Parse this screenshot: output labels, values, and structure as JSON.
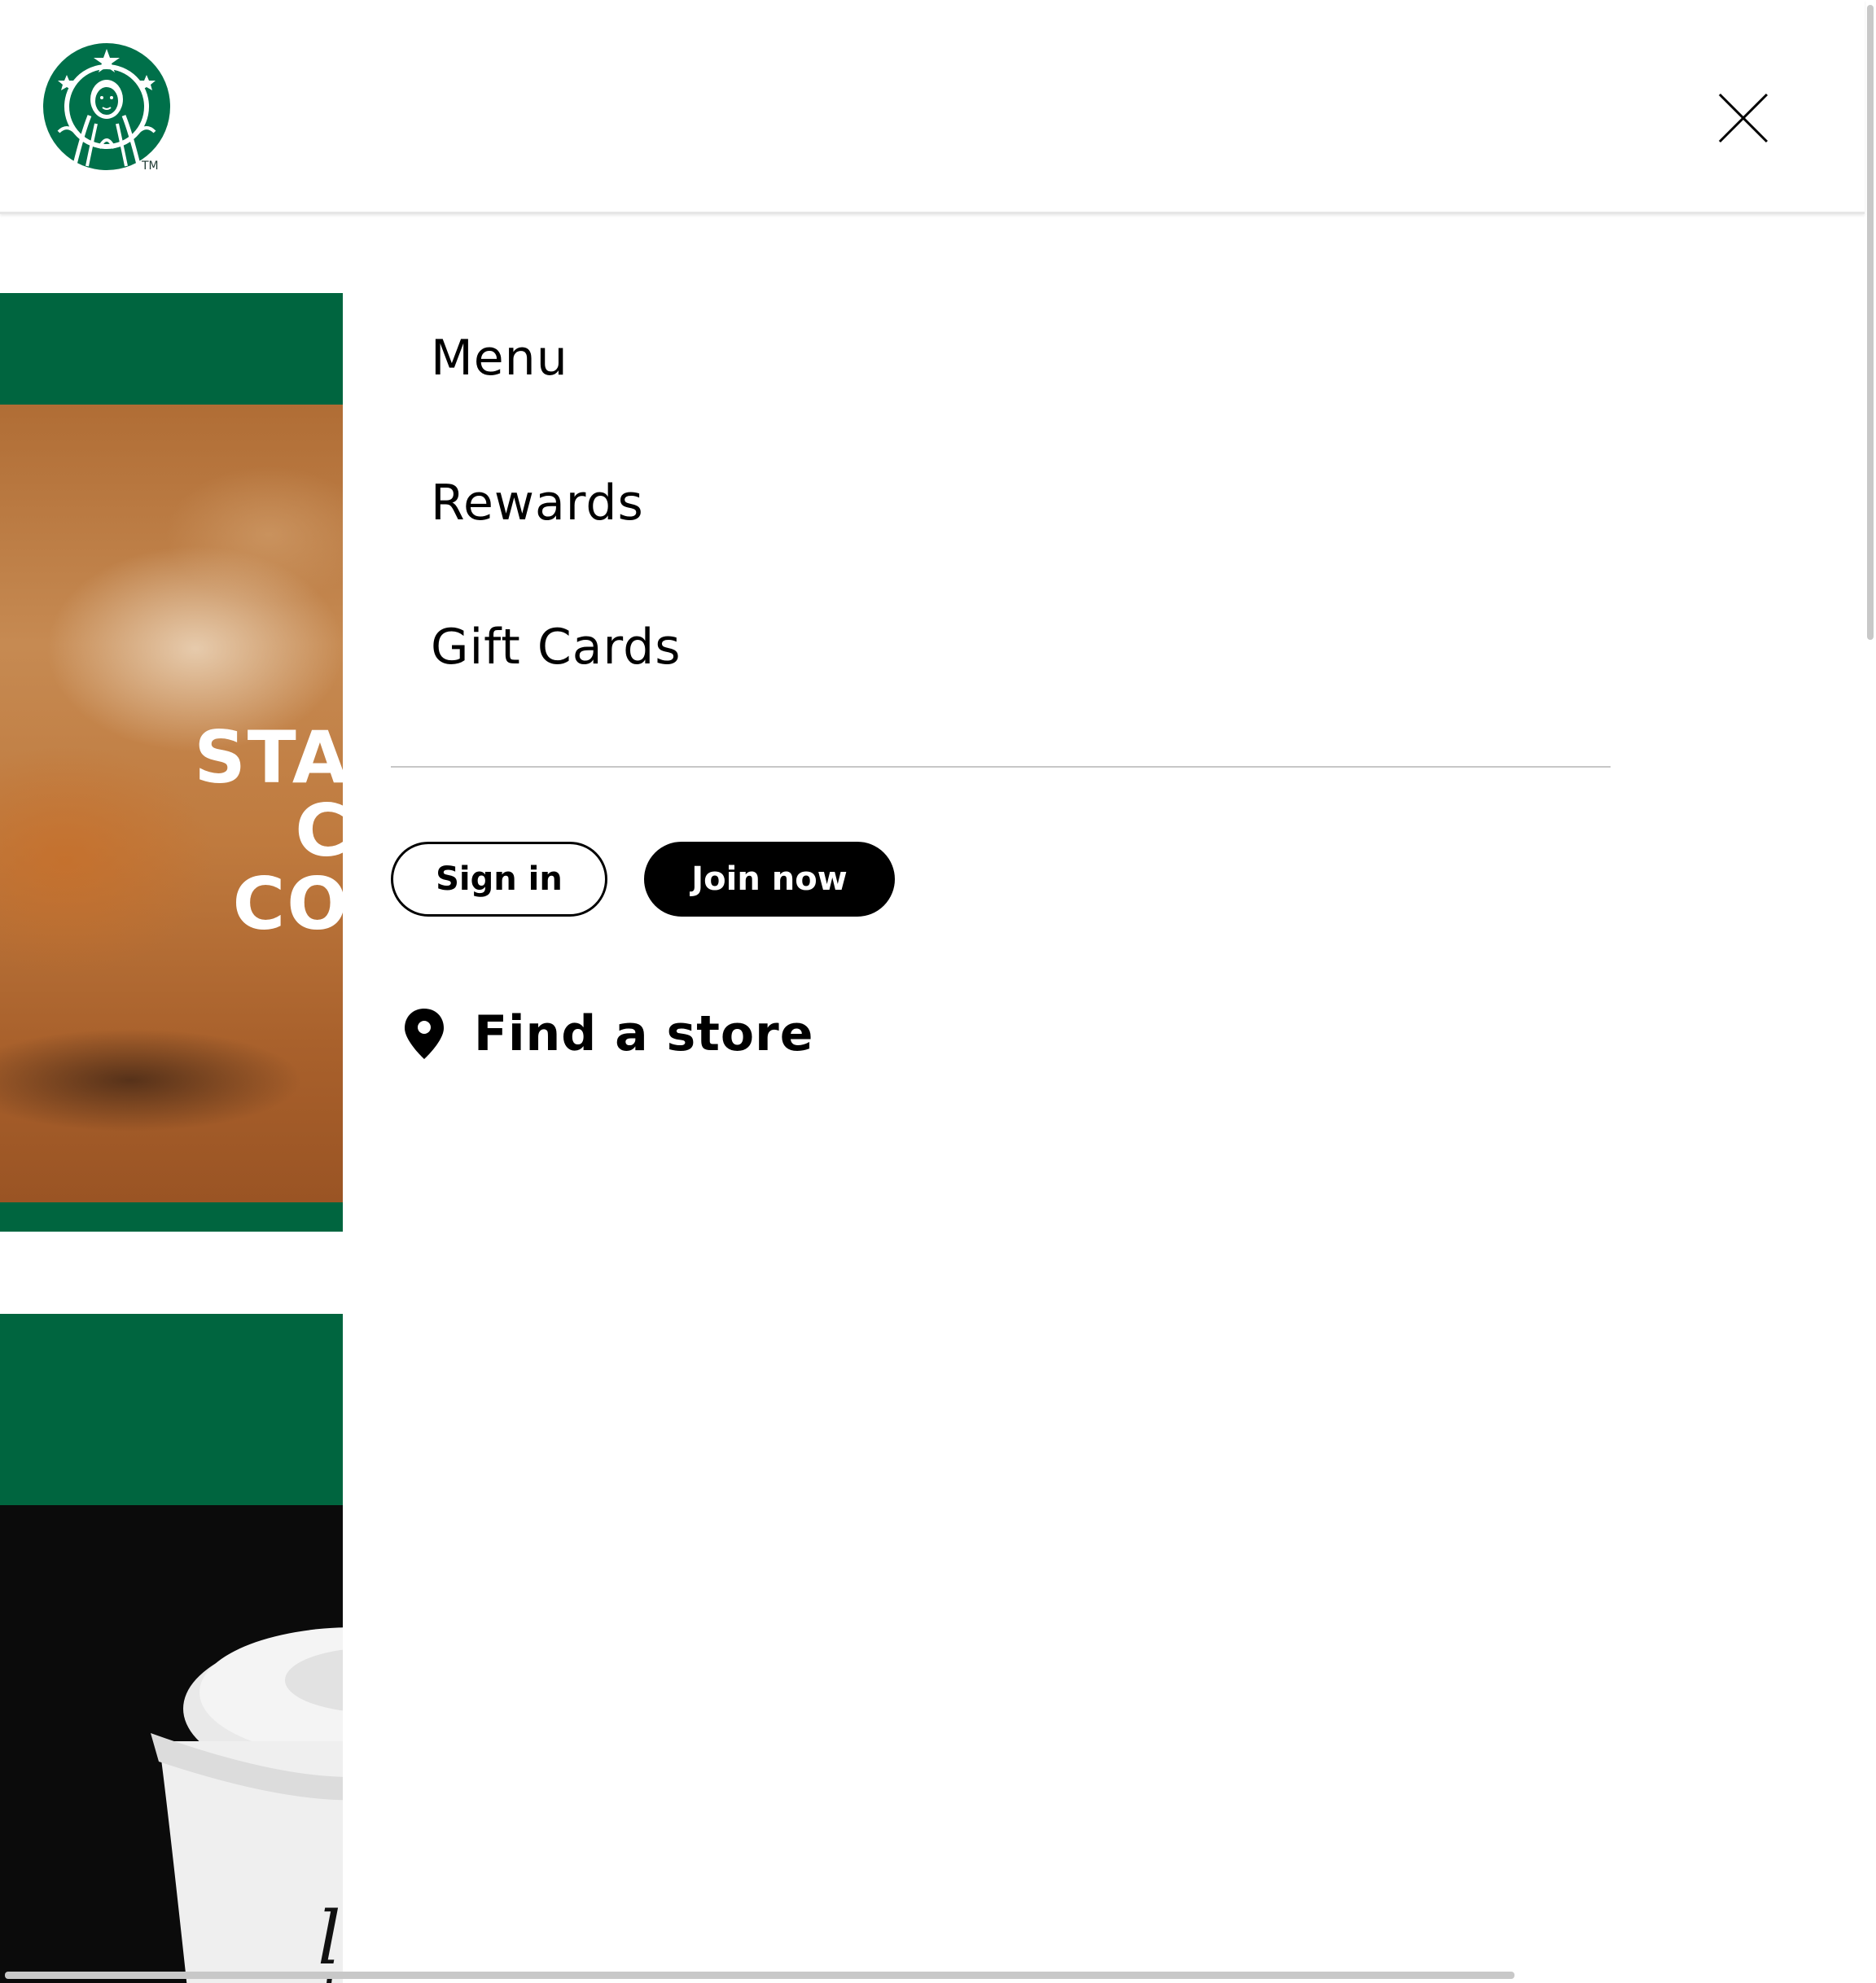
{
  "header": {
    "logo_icon": "starbucks-siren-logo",
    "logo_trademark": "TM",
    "close_icon": "close-icon"
  },
  "nav": {
    "items": [
      {
        "label": "Menu"
      },
      {
        "label": "Rewards"
      },
      {
        "label": "Gift Cards"
      }
    ],
    "sign_in_label": "Sign in",
    "join_now_label": "Join now",
    "find_store_icon": "location-pin-icon",
    "find_store_label": "Find a store"
  },
  "background_page": {
    "promo_text_lines": [
      "STA",
      "C",
      "CO"
    ],
    "cup_note": "l"
  },
  "colors": {
    "brand_green": "#00653f",
    "logo_green": "#00704a",
    "text": "#000000",
    "divider": "#c7c7c7"
  }
}
